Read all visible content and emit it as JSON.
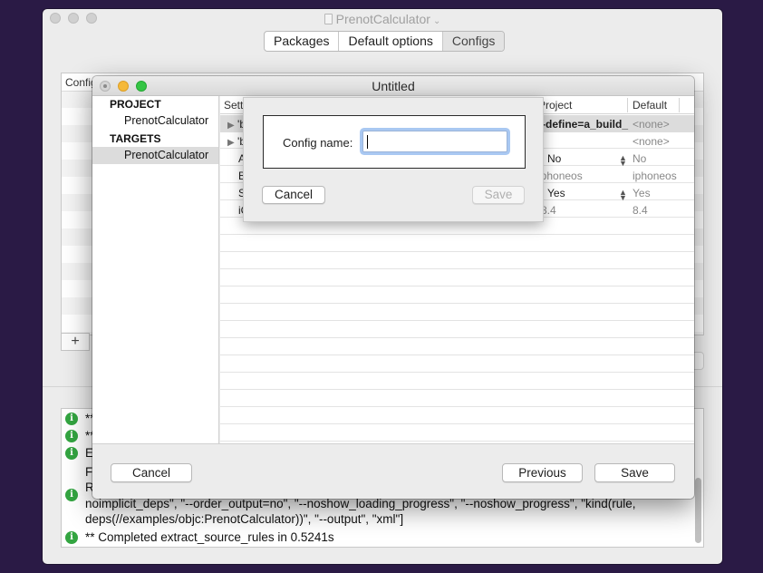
{
  "main_window": {
    "title": "PrenotCalculator",
    "tabs": [
      {
        "label": "Packages"
      },
      {
        "label": "Default options"
      },
      {
        "label": "Configs"
      }
    ],
    "table_header": "Config",
    "add_label": "+"
  },
  "log": {
    "lines": [
      {
        "text": "**"
      },
      {
        "text": "**"
      },
      {
        "text": "Ex"
      },
      {
        "text": "Fo"
      },
      {
        "text": "R"
      },
      {
        "text": "noimplicit_deps\", \"--order_output=no\", \"--noshow_loading_progress\", \"--noshow_progress\", \"kind(rule,"
      },
      {
        "text": "deps(//examples/objc:PrenotCalculator))\", \"--output\", \"xml\"]"
      },
      {
        "text": "** Completed extract_source_rules in 0.5241s"
      }
    ]
  },
  "config_window": {
    "title": "Untitled",
    "sidebar": {
      "project_header": "PROJECT",
      "project_item": "PrenotCalculator",
      "targets_header": "TARGETS",
      "target_item": "PrenotCalculator"
    },
    "table": {
      "headers": {
        "setting": "Setti",
        "project": "Project",
        "default": "Default"
      },
      "rows": [
        {
          "setting": "'b",
          "project": "--define=a_build_",
          "default": "<none>"
        },
        {
          "setting": "'b",
          "project": "",
          "default": "<none>"
        },
        {
          "setting": "A",
          "project": "No",
          "default": "No"
        },
        {
          "setting": "B",
          "project": "iphoneos",
          "default": "iphoneos"
        },
        {
          "setting": "S",
          "project": "Yes",
          "default": "Yes"
        },
        {
          "setting": "iC",
          "project": "8.4",
          "default": "8.4"
        }
      ]
    },
    "buttons": {
      "cancel": "Cancel",
      "previous": "Previous",
      "save": "Save"
    }
  },
  "sheet": {
    "label": "Config name:",
    "input_value": "",
    "cancel": "Cancel",
    "save": "Save"
  },
  "colors": {
    "desktop": "#2a1a45",
    "info_icon": "#33a541",
    "focus_ring": "#a9c8f2"
  },
  "icons": [
    "doc-icon",
    "chevron-down-icon",
    "info-icon",
    "disclosure-triangle-icon",
    "stepper-icon"
  ]
}
